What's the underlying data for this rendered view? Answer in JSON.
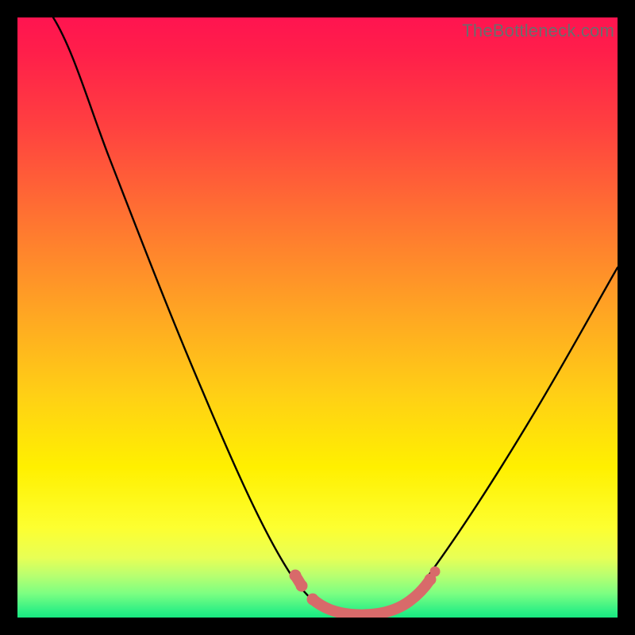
{
  "watermark": "TheBottleneck.com",
  "chart_data": {
    "type": "line",
    "title": "",
    "xlabel": "",
    "ylabel": "",
    "xlim": [
      0,
      100
    ],
    "ylim": [
      0,
      100
    ],
    "series": [
      {
        "name": "bottleneck-curve",
        "x": [
          6,
          10,
          15,
          20,
          25,
          30,
          35,
          40,
          45,
          48,
          50,
          52,
          55,
          57,
          60,
          65,
          70,
          75,
          80,
          85,
          90,
          95,
          100
        ],
        "y": [
          100,
          92,
          82,
          71,
          60,
          49,
          38,
          27,
          15,
          7,
          3,
          1,
          0,
          0,
          0,
          2,
          6,
          13,
          22,
          31,
          40,
          48,
          56
        ]
      }
    ],
    "highlight": {
      "name": "optimal-range",
      "color": "#d86a6a",
      "points": [
        {
          "x": 47,
          "y": 9
        },
        {
          "x": 48,
          "y": 6
        },
        {
          "x": 50,
          "y": 3
        },
        {
          "x": 52,
          "y": 1
        },
        {
          "x": 55,
          "y": 0.5
        },
        {
          "x": 58,
          "y": 0.5
        },
        {
          "x": 61,
          "y": 1
        },
        {
          "x": 63,
          "y": 2
        },
        {
          "x": 65,
          "y": 4
        },
        {
          "x": 66,
          "y": 6
        }
      ]
    },
    "gradient_stops": [
      {
        "pos": 0,
        "color": "#ff1450"
      },
      {
        "pos": 50,
        "color": "#ffa822"
      },
      {
        "pos": 80,
        "color": "#fff000"
      },
      {
        "pos": 100,
        "color": "#18e880"
      }
    ]
  }
}
